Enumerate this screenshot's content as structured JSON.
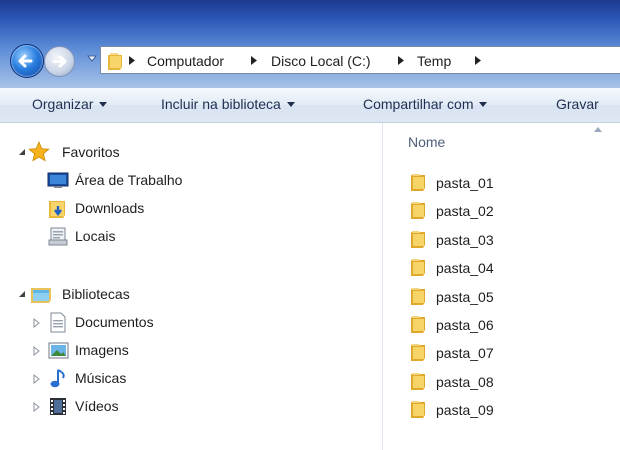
{
  "breadcrumb": [
    "Computador",
    "Disco Local (C:)",
    "Temp"
  ],
  "toolbar": {
    "organize": "Organizar",
    "include_library": "Incluir na biblioteca",
    "share_with": "Compartilhar com",
    "burn": "Gravar"
  },
  "nav": {
    "favorites": {
      "label": "Favoritos",
      "items": [
        {
          "label": "Área de Trabalho",
          "icon": "desktop-icon"
        },
        {
          "label": "Downloads",
          "icon": "downloads-folder-icon"
        },
        {
          "label": "Locais",
          "icon": "recent-places-icon"
        }
      ]
    },
    "libraries": {
      "label": "Bibliotecas",
      "items": [
        {
          "label": "Documentos",
          "icon": "documents-icon"
        },
        {
          "label": "Imagens",
          "icon": "pictures-icon"
        },
        {
          "label": "Músicas",
          "icon": "music-icon"
        },
        {
          "label": "Vídeos",
          "icon": "videos-icon"
        }
      ]
    }
  },
  "files": {
    "column_header": "Nome",
    "items": [
      "pasta_01",
      "pasta_02",
      "pasta_03",
      "pasta_04",
      "pasta_05",
      "pasta_06",
      "pasta_07",
      "pasta_08",
      "pasta_09"
    ]
  },
  "colors": {
    "title_gradient_top": "#1d3a8f",
    "command_text": "#1e2f50",
    "folder_yellow": "#f2c64d"
  }
}
